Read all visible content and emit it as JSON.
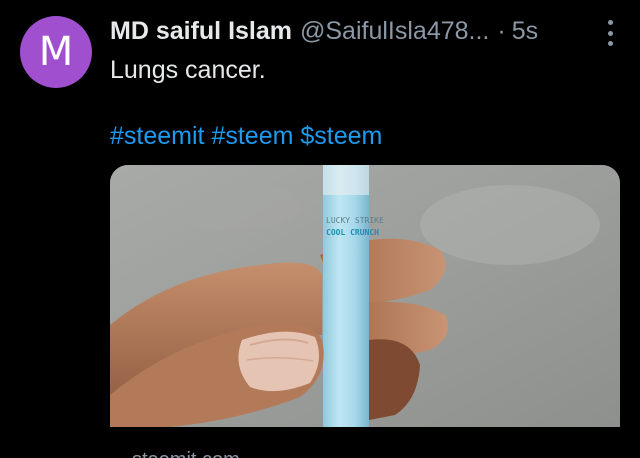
{
  "colors": {
    "avatar_bg": "#a04fcf",
    "name": "#e7e9ea",
    "muted": "#8b98a5",
    "link": "#1d9bf0"
  },
  "tweet": {
    "avatar_letter": "M",
    "display_name": "MD saiful Islam",
    "handle": "@SaifulIsla478...",
    "separator": "·",
    "time": "5s",
    "text": "Lungs cancer.",
    "hashtags": [
      "#steemit",
      "#steem",
      "$steem"
    ],
    "more_icon": "more-vertical-icon"
  },
  "media": {
    "image_subject": "photo of a hand holding a cigarette",
    "cigarette_brand_line1": "LUCKY STRIKE",
    "cigarette_brand_line2": "COOL CRUNCH",
    "link_domain": "steemit.com"
  }
}
